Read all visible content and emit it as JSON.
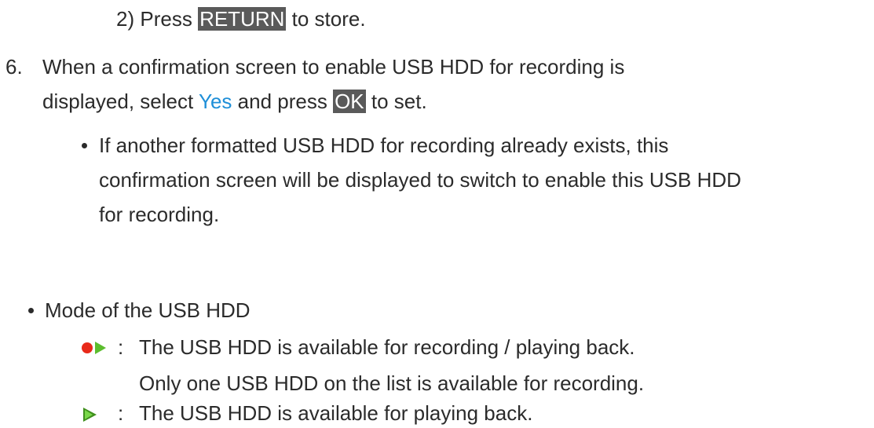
{
  "step_2": {
    "number": "2)",
    "press": "Press",
    "key": "RETURN",
    "suffix": "to store."
  },
  "step_6": {
    "number": "6.",
    "line1": "When a confirmation screen to enable USB HDD for recording is",
    "line2_prefix": "displayed, select",
    "yes": "Yes",
    "line2_mid": "and press",
    "ok_key": "OK",
    "line2_suffix": "to set.",
    "note": {
      "line1": "If another formatted USB HDD for recording already exists, this",
      "line2": "confirmation screen will be displayed to switch to enable this USB HDD",
      "line3": "for recording."
    }
  },
  "mode_section": {
    "title": "Mode of the USB HDD",
    "items": [
      {
        "icon": "record-play-icon",
        "separator": ":",
        "line1": "The USB HDD is available for recording / playing back.",
        "line2": "Only one USB HDD on the list is available for recording."
      },
      {
        "icon": "play-icon",
        "separator": ":",
        "line1": "The USB HDD is available for playing back."
      }
    ]
  },
  "colors": {
    "text": "#2b2b2b",
    "key_background": "#5a5a5a",
    "link": "#1f8fd8",
    "record_dot": "#e8291a",
    "play_triangle": "#5cbd2e"
  }
}
